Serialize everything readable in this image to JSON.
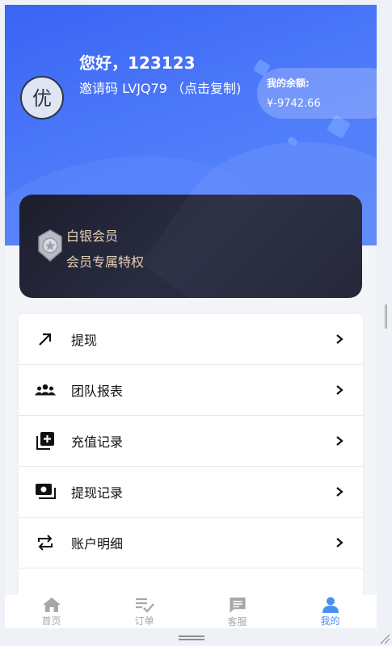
{
  "profile": {
    "greeting": "您好，123123",
    "invite_text": "邀请码 LVJQ79 （点击复制)",
    "avatar_text": "优"
  },
  "balance": {
    "label": "我的余额:",
    "value": "¥-9742.66"
  },
  "vip": {
    "level": "白银会员",
    "privilege": "会员专属特权"
  },
  "menu": {
    "items": [
      {
        "label": "提现",
        "icon": "arrow-up-right-icon"
      },
      {
        "label": "团队报表",
        "icon": "group-icon"
      },
      {
        "label": "充值记录",
        "icon": "add-box-icon"
      },
      {
        "label": "提现记录",
        "icon": "cash-icon"
      },
      {
        "label": "账户明细",
        "icon": "swap-icon"
      }
    ]
  },
  "tabbar": {
    "tabs": [
      {
        "label": "首页",
        "icon": "home-icon"
      },
      {
        "label": "订单",
        "icon": "order-list-icon"
      },
      {
        "label": "客服",
        "icon": "chat-icon"
      },
      {
        "label": "我的",
        "icon": "person-icon"
      }
    ],
    "active": "我的"
  },
  "colors": {
    "header": "#4a74f7",
    "vip_card": "#1f2133",
    "vip_text": "#e8d2b4",
    "active_tab": "#4a8ef5"
  }
}
